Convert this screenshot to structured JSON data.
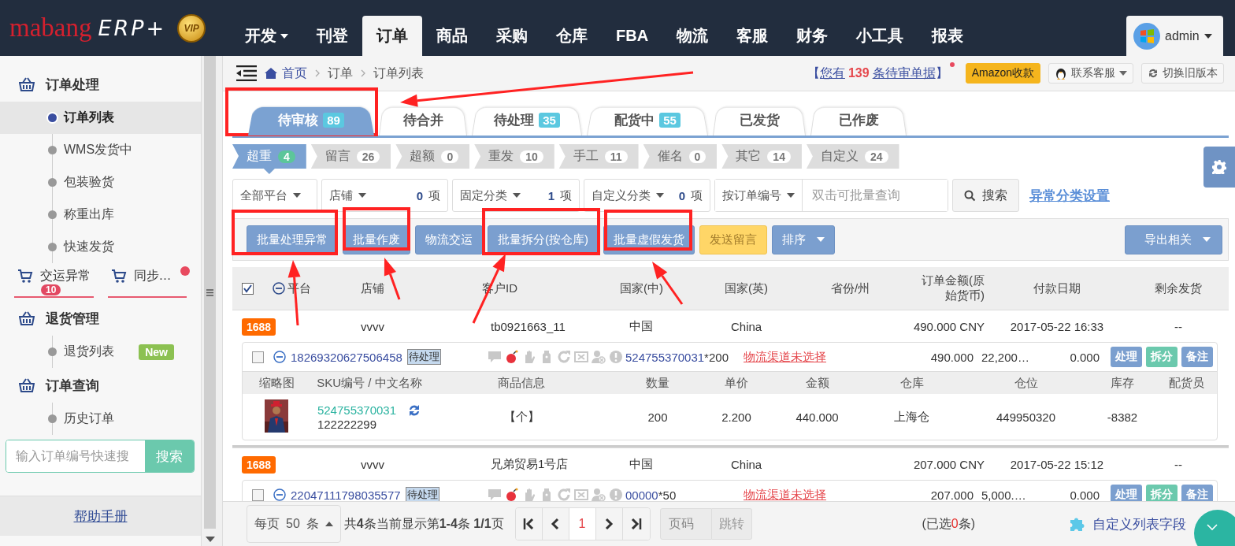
{
  "logo": {
    "brand": "mabang",
    "product": "ERP+",
    "badge": "VIP"
  },
  "nav": [
    {
      "label": "开发",
      "dropdown": true,
      "selected": false
    },
    {
      "label": "刊登",
      "dropdown": false,
      "selected": false
    },
    {
      "label": "订单",
      "dropdown": false,
      "selected": true
    },
    {
      "label": "商品",
      "dropdown": false,
      "selected": false
    },
    {
      "label": "采购",
      "dropdown": false,
      "selected": false
    },
    {
      "label": "仓库",
      "dropdown": false,
      "selected": false
    },
    {
      "label": "FBA",
      "dropdown": false,
      "selected": false
    },
    {
      "label": "物流",
      "dropdown": false,
      "selected": false
    },
    {
      "label": "客服",
      "dropdown": false,
      "selected": false
    },
    {
      "label": "财务",
      "dropdown": false,
      "selected": false
    },
    {
      "label": "小工具",
      "dropdown": false,
      "selected": false
    },
    {
      "label": "报表",
      "dropdown": false,
      "selected": false
    }
  ],
  "user": {
    "name": "admin"
  },
  "sidebar": {
    "sections": [
      {
        "kind": "group",
        "title": "订单处理",
        "items": [
          {
            "label": "订单列表",
            "selected": true
          },
          {
            "label": "WMS发货中",
            "selected": false
          },
          {
            "label": "包装验货",
            "selected": false
          },
          {
            "label": "称重出库",
            "selected": false
          },
          {
            "label": "快速发货",
            "selected": false
          }
        ]
      },
      {
        "kind": "shortcuts",
        "items": [
          {
            "label": "交运异常",
            "badge": "10",
            "dot": false
          },
          {
            "label": "同步…",
            "dot": true
          }
        ]
      },
      {
        "kind": "group",
        "title": "退货管理",
        "items": [
          {
            "label": "退货列表",
            "selected": false,
            "badge": "New"
          }
        ]
      },
      {
        "kind": "group",
        "title": "订单查询",
        "items": [
          {
            "label": "历史订单",
            "selected": false
          }
        ]
      },
      {
        "kind": "search",
        "placeholder": "输入订单编号快速搜",
        "button": "搜索"
      }
    ],
    "help": "帮助手册"
  },
  "breadcrumb": [
    "首页",
    "订单",
    "订单列表"
  ],
  "notice": {
    "open": "【",
    "text": "您有",
    "count": "139",
    "tail": "条待审单据",
    "close": "】",
    "dot": true
  },
  "header_buttons": [
    {
      "kind": "amazon",
      "label": "Amazon收款"
    },
    {
      "kind": "contact",
      "label": "联系客服"
    },
    {
      "kind": "switch",
      "label": "切换旧版本"
    }
  ],
  "status_tabs": [
    {
      "label": "待审核",
      "count": "89",
      "selected": true
    },
    {
      "label": "待合并",
      "selected": false
    },
    {
      "label": "待处理",
      "count": "35",
      "selected": false
    },
    {
      "label": "配货中",
      "count": "55",
      "selected": false
    },
    {
      "label": "已发货",
      "selected": false
    },
    {
      "label": "已作废",
      "selected": false
    }
  ],
  "sub_tabs": [
    {
      "label": "超重",
      "count": "4",
      "selected": true
    },
    {
      "label": "留言",
      "count": "26",
      "selected": false
    },
    {
      "label": "超额",
      "count": "0",
      "selected": false
    },
    {
      "label": "重发",
      "count": "10",
      "selected": false
    },
    {
      "label": "手工",
      "count": "11",
      "selected": false
    },
    {
      "label": "催名",
      "count": "0",
      "selected": false
    },
    {
      "label": "其它",
      "count": "14",
      "selected": false
    },
    {
      "label": "自定义",
      "count": "24",
      "selected": false
    }
  ],
  "filters": [
    {
      "kind": "select",
      "label": "全部平台"
    },
    {
      "kind": "count_select",
      "label": "店铺",
      "count": "0",
      "unit": "项"
    },
    {
      "kind": "count_select",
      "label": "固定分类",
      "count": "1",
      "unit": "项"
    },
    {
      "kind": "count_select",
      "label": "自定义分类",
      "count": "0",
      "unit": "项"
    },
    {
      "kind": "search",
      "label": "按订单编号",
      "placeholder": "双击可批量查询",
      "button": "搜索"
    },
    {
      "kind": "link",
      "label": "异常分类设置"
    }
  ],
  "actions": [
    {
      "kind": "primary",
      "label": "批量处理异常"
    },
    {
      "kind": "primary",
      "label": "批量作废"
    },
    {
      "kind": "primary",
      "label": "物流交运"
    },
    {
      "kind": "primary",
      "label": "批量拆分(按仓库)"
    },
    {
      "kind": "primary",
      "label": "批量虚假发货"
    },
    {
      "kind": "warning",
      "label": "发送留言"
    },
    {
      "kind": "dropdown",
      "label": "排序"
    }
  ],
  "export": {
    "label": "导出相关"
  },
  "table": {
    "all_checked": true,
    "columns": [
      "平台",
      "店铺",
      "客户ID",
      "国家(中)",
      "国家(英)",
      "省份/州",
      "订单金额(原始货币)",
      "付款日期",
      "剩余发货"
    ],
    "item_columns": [
      "缩略图",
      "SKU编号 / 中文名称",
      "商品信息",
      "数量",
      "单价",
      "金额",
      "仓库",
      "仓位",
      "库存",
      "配货员"
    ],
    "orders": [
      {
        "platform": "1688",
        "shop": "vvvv",
        "customer": "tb0921663_11",
        "country_cn": "中国",
        "country_en": "China",
        "amount": "490.000 CNY",
        "paid": "2017-05-22 16:33",
        "remaining": "--",
        "line": {
          "checked": false,
          "order_no": "18269320627506458",
          "status": "待处理",
          "sku": "524755370031",
          "qty": "*200",
          "logistics": "物流渠道未选择",
          "amount": "490.000",
          "column_2": "22,200…",
          "column_3": "0.000",
          "buttons": [
            "处理",
            "拆分",
            "备注"
          ]
        },
        "items": [
          {
            "sku": "524755370031",
            "name": "122222299",
            "info": "【个】",
            "qty": "200",
            "price": "2.200",
            "amount": "440.000",
            "warehouse": "上海仓",
            "location": "449950320",
            "stock": "-8382"
          }
        ]
      },
      {
        "platform": "1688",
        "shop": "vvvv",
        "customer": "兄弟贸易1号店",
        "country_cn": "中国",
        "country_en": "China",
        "amount": "207.000 CNY",
        "paid": "2017-05-22 15:12",
        "remaining": "--",
        "line": {
          "checked": false,
          "order_no": "22047111798035577",
          "status": "待处理",
          "sku": "00000",
          "qty": "*50",
          "logistics": "物流渠道未选择",
          "amount": "207.000",
          "column_2": "5,000.…",
          "column_3": "0.000",
          "buttons": [
            "处理",
            "拆分",
            "备注"
          ]
        }
      }
    ]
  },
  "footer": {
    "page_size": {
      "label": "每页",
      "value": "50",
      "unit": "条"
    },
    "summary": "共**4**条当前显示第**1-4**条 **1/1**页",
    "pages": [
      {
        "label": "1",
        "selected": true
      }
    ],
    "page_placeholder": "页码",
    "jump": "跳转",
    "selection": {
      "open": "(已选",
      "count": "0",
      "close": "条)"
    },
    "custom_fields": "自定义列表字段"
  }
}
